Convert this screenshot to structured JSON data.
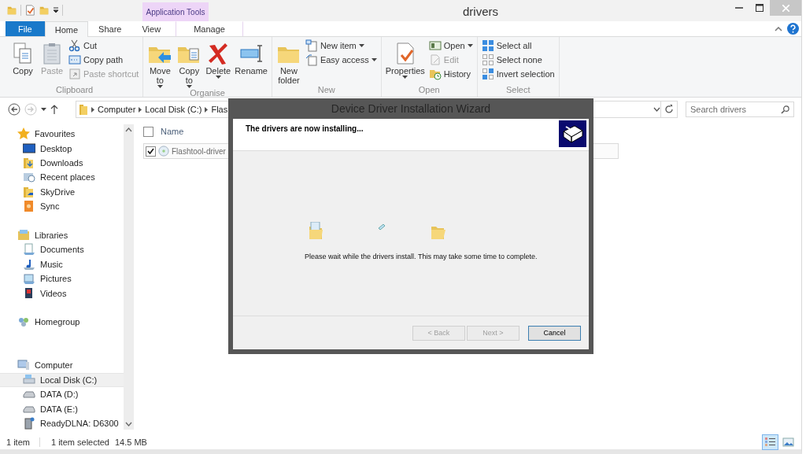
{
  "window": {
    "title": "drivers"
  },
  "context_tabs": {
    "label": "Application Tools"
  },
  "ribbon_tabs": [
    {
      "label": "File",
      "kind": "file",
      "selected": false
    },
    {
      "label": "Home",
      "kind": "tab",
      "selected": true
    },
    {
      "label": "Share",
      "kind": "tab",
      "selected": false
    },
    {
      "label": "View",
      "kind": "tab",
      "selected": false
    },
    {
      "label": "Manage",
      "kind": "context",
      "selected": false
    }
  ],
  "ribbon_groups": [
    {
      "label": "Clipboard",
      "items": [
        {
          "label": "Copy",
          "kind": "large",
          "disabled": false,
          "dropdown": false
        },
        {
          "label": "Paste",
          "kind": "large",
          "disabled": true,
          "dropdown": false
        },
        {
          "label": "Cut",
          "kind": "small",
          "disabled": false,
          "dropdown": false
        },
        {
          "label": "Copy path",
          "kind": "small",
          "disabled": false,
          "dropdown": false
        },
        {
          "label": "Paste shortcut",
          "kind": "small",
          "disabled": true,
          "dropdown": false
        }
      ]
    },
    {
      "label": "Organise",
      "items": [
        {
          "label": "Move to",
          "kind": "large",
          "disabled": false,
          "dropdown": true
        },
        {
          "label": "Copy to",
          "kind": "large",
          "disabled": false,
          "dropdown": true
        },
        {
          "label": "Delete",
          "kind": "large",
          "disabled": false,
          "dropdown": true
        },
        {
          "label": "Rename",
          "kind": "large",
          "disabled": false,
          "dropdown": false
        }
      ]
    },
    {
      "label": "New",
      "items": [
        {
          "label": "New folder",
          "kind": "large",
          "disabled": false,
          "dropdown": false
        },
        {
          "label": "New item",
          "kind": "small",
          "disabled": false,
          "dropdown": true
        },
        {
          "label": "Easy access",
          "kind": "small",
          "disabled": false,
          "dropdown": true
        }
      ]
    },
    {
      "label": "Open",
      "items": [
        {
          "label": "Properties",
          "kind": "large",
          "disabled": false,
          "dropdown": true
        },
        {
          "label": "Open",
          "kind": "small",
          "disabled": false,
          "dropdown": true
        },
        {
          "label": "Edit",
          "kind": "small",
          "disabled": true,
          "dropdown": false
        },
        {
          "label": "History",
          "kind": "small",
          "disabled": false,
          "dropdown": false
        }
      ]
    },
    {
      "label": "Select",
      "items": [
        {
          "label": "Select all",
          "kind": "small",
          "disabled": false,
          "dropdown": false
        },
        {
          "label": "Select none",
          "kind": "small",
          "disabled": false,
          "dropdown": false
        },
        {
          "label": "Invert selection",
          "kind": "small",
          "disabled": false,
          "dropdown": false
        }
      ]
    }
  ],
  "address": {
    "crumbs": [
      "Computer",
      "Local Disk (C:)",
      "Flas"
    ]
  },
  "search": {
    "placeholder": "Search drivers"
  },
  "navigation": [
    {
      "label": "Favourites",
      "selected": false,
      "children": [
        {
          "label": "Desktop",
          "selected": false
        },
        {
          "label": "Downloads",
          "selected": false
        },
        {
          "label": "Recent places",
          "selected": false
        },
        {
          "label": "SkyDrive",
          "selected": false
        },
        {
          "label": "Sync",
          "selected": false
        }
      ]
    },
    {
      "label": "Libraries",
      "selected": false,
      "children": [
        {
          "label": "Documents",
          "selected": false
        },
        {
          "label": "Music",
          "selected": false
        },
        {
          "label": "Pictures",
          "selected": false
        },
        {
          "label": "Videos",
          "selected": false
        }
      ]
    },
    {
      "label": "Homegroup",
      "selected": false
    },
    {
      "label": "Computer",
      "selected": false,
      "children": [
        {
          "label": "Local Disk (C:)",
          "selected": true
        },
        {
          "label": "DATA (D:)",
          "selected": false
        },
        {
          "label": "DATA (E:)",
          "selected": false
        },
        {
          "label": "ReadyDLNA: D6300",
          "selected": false
        }
      ]
    }
  ],
  "file_list": {
    "columns": [
      "Name"
    ],
    "header_checked": false,
    "files": [
      {
        "name": "Flashtool-driver",
        "checked": true,
        "selected": true
      }
    ]
  },
  "status_bar": {
    "item_count": "1 item",
    "selection": "1 item selected",
    "size": "14.5 MB"
  },
  "view_buttons": [
    {
      "selected": true
    },
    {
      "selected": false
    }
  ],
  "dialog": {
    "title": "Device Driver Installation Wizard",
    "heading": "The drivers are now installing...",
    "message": "Please wait while the drivers install. This may take some time to complete.",
    "buttons": [
      {
        "label": "< Back",
        "disabled": true,
        "default": false
      },
      {
        "label": "Next >",
        "disabled": true,
        "default": false
      },
      {
        "label": "Cancel",
        "disabled": false,
        "default": true
      }
    ]
  }
}
